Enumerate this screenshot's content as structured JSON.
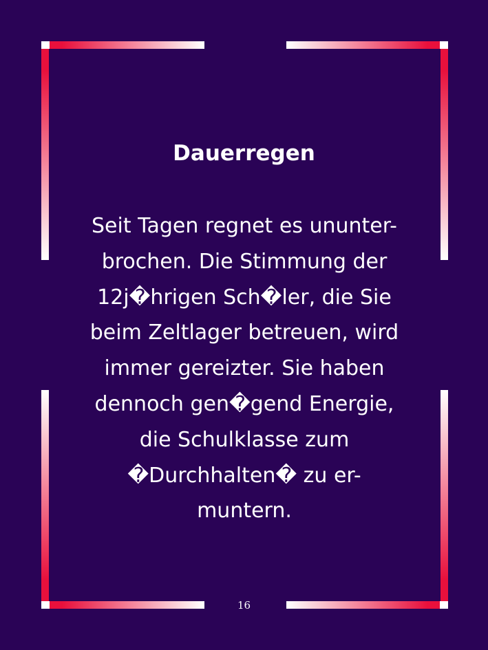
{
  "card": {
    "title": "Dauerregen",
    "body_lines": [
      "Seit Tagen regnet es ununter-",
      "brochen. Die Stimmung der",
      "12j�hrigen Sch�ler, die Sie",
      "beim Zeltlager betreuen, wird",
      "immer gereizter. Sie haben",
      "dennoch gen�gend Energie,",
      "die Schulklasse zum",
      "�Durchhalten� zu er-",
      "muntern."
    ],
    "page_number": "16"
  },
  "colors": {
    "background": "#2a0356",
    "frame_accent": "#e8103c",
    "frame_light": "#ffffff",
    "text": "#ffffff"
  }
}
